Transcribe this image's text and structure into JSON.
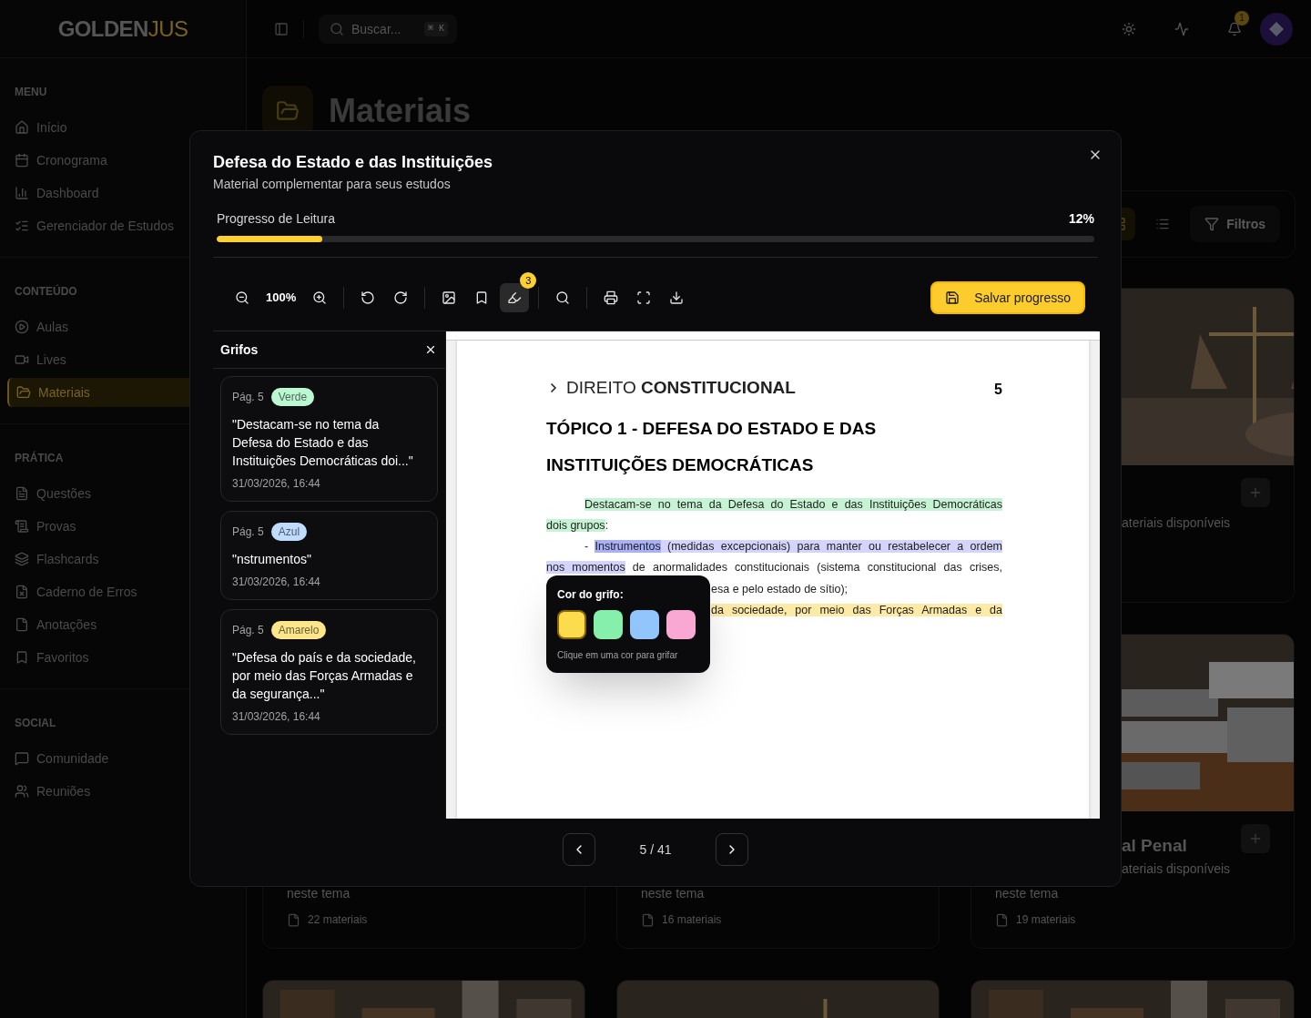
{
  "sidebar": {
    "logo": [
      "GOLDEN",
      "JUS"
    ],
    "sections": [
      {
        "title": "MENU",
        "items": [
          {
            "label": "Início",
            "selected": false
          },
          {
            "label": "Cronograma",
            "selected": false
          },
          {
            "label": "Dashboard",
            "selected": false
          },
          {
            "label": "Gerenciador de Estudos",
            "selected": false
          }
        ]
      },
      {
        "title": "CONTEÚDO",
        "items": [
          {
            "label": "Aulas",
            "selected": false
          },
          {
            "label": "Lives",
            "selected": false
          },
          {
            "label": "Materiais",
            "selected": true
          }
        ]
      },
      {
        "title": "PRÁTICA",
        "items": [
          {
            "label": "Questões",
            "selected": false
          },
          {
            "label": "Provas",
            "selected": false
          },
          {
            "label": "Flashcards",
            "selected": false
          },
          {
            "label": "Caderno de Erros",
            "selected": false
          },
          {
            "label": "Anotações",
            "selected": false
          },
          {
            "label": "Favoritos",
            "selected": false
          }
        ]
      },
      {
        "title": "SOCIAL",
        "items": [
          {
            "label": "Comunidade",
            "selected": false
          },
          {
            "label": "Reuniões",
            "selected": false
          }
        ]
      }
    ]
  },
  "header": {
    "search": {
      "placeholder": "Buscar...",
      "shortcut": "⌘ K"
    },
    "notifications": "1"
  },
  "page": {
    "title": "Materiais",
    "views": [
      {
        "selected": true
      },
      {
        "selected": false
      }
    ],
    "filter_button": "Filtros",
    "cards": [
      {
        "subtitle": "ateriais disponíveis"
      },
      {
        "subtitle_2": "neste tema",
        "count": "22 materiais"
      },
      {
        "subtitle_2": "neste tema",
        "count": "16 materiais"
      },
      {
        "title": "al Penal",
        "subtitle": "ateriais disponíveis",
        "subtitle_2": "neste tema",
        "count": "19 materiais"
      }
    ]
  },
  "modal": {
    "title": "Defesa do Estado e das Instituições",
    "subtitle": "Material complementar para seus estudos",
    "progress": {
      "label": "Progresso de Leitura",
      "reading": "12%",
      "level": 0.12
    },
    "toolbar": {
      "zoom": "100%",
      "highlighter": {
        "selected": true,
        "badge": "3"
      }
    },
    "save_button": "Salvar progresso",
    "highlights_panel": {
      "title": "Grifos",
      "items": [
        {
          "page": "Pág. 5",
          "tag": {
            "label": "Verde",
            "color": "#bbf7d0"
          },
          "quote": "\"Destacam-se no tema da Defesa do Estado e das Instituições Democráticas doi...\"",
          "date": "31/03/2026, 16:44"
        },
        {
          "page": "Pág. 5",
          "tag": {
            "label": "Azul",
            "color": "#bfdbfe"
          },
          "quote": "\"nstrumentos\"",
          "date": "31/03/2026, 16:44"
        },
        {
          "page": "Pág. 5",
          "tag": {
            "label": "Amarelo",
            "color": "#fde68a"
          },
          "quote": "\"Defesa do país e da sociedade, por meio das Forças Armadas e da segurança...\"",
          "date": "31/03/2026, 16:44"
        }
      ]
    },
    "document": {
      "section": [
        "DIREITO",
        "CONSTITUCIONAL"
      ],
      "page_number": "5",
      "heading": [
        "TÓPICO 1 - DEFESA DO ESTADO E DAS",
        "INSTITUIÇÕES DEMOCRÁTICAS"
      ],
      "lines": [
        {
          "kind": "indent",
          "covered": false,
          "segments": [
            {
              "text": "Destacam-se no tema da Defesa do Estado e das Instituições Democráticas",
              "color": "#c6f3d3"
            }
          ]
        },
        {
          "kind": "short",
          "covered": false,
          "segments": [
            {
              "text": "dois grupos",
              "color": "#c6f3d3"
            },
            {
              "text": ":"
            }
          ]
        },
        {
          "kind": "indent",
          "covered": false,
          "segments": [
            {
              "text": "- "
            },
            {
              "text": "Instrumentos",
              "color": "#a9b0fa"
            },
            {
              "text": " (medidas excepcionais) para manter ou restabelecer a ordem",
              "color": "#d4d4fc"
            }
          ]
        },
        {
          "kind": "full",
          "covered": false,
          "segments": [
            {
              "text": "nos momentos",
              "color": "#d4d4fc"
            },
            {
              "text": " de anormalidades constitucionais (sistema constitucional das crises,"
            }
          ]
        },
        {
          "kind": "short",
          "covered": true,
          "segments": [
            {
              "text": "esa e pelo estado de sítio);"
            }
          ]
        },
        {
          "kind": "full",
          "covered": true,
          "segments": [
            {
              "text": "da sociedade, por meio das Forças Armadas e da",
              "color": "#fdeaa7"
            }
          ]
        }
      ]
    },
    "color_picker": {
      "title": "Cor do grifo:",
      "swatches": [
        {
          "color": "#fcdc4d",
          "selected": true
        },
        {
          "color": "#86efac",
          "selected": false
        },
        {
          "color": "#93c5fd",
          "selected": false
        },
        {
          "color": "#f9a8d4",
          "selected": false
        }
      ],
      "hint": "Clique em uma cor para grifar"
    },
    "pager": {
      "page": "5 / 41"
    }
  }
}
